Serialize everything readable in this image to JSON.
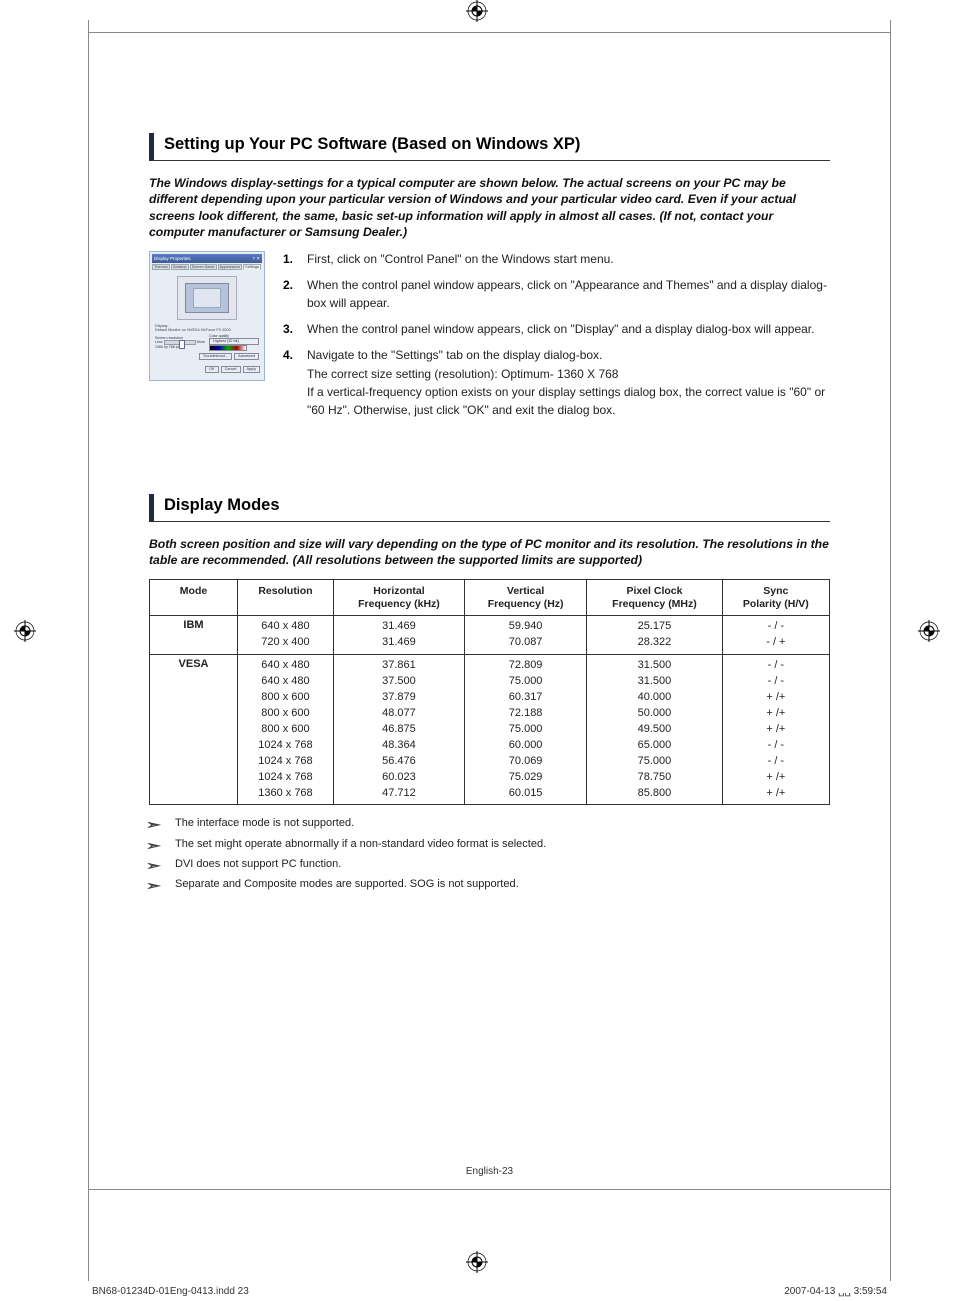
{
  "section1": {
    "heading": "Setting up Your PC Software (Based on Windows XP)",
    "intro": "The Windows display-settings for a typical computer are shown below. The actual screens on your PC may be different depending upon your particular version of Windows and your particular video card. Even if your actual screens look different, the same, basic set-up information will apply in almost all cases. (If not, contact your computer manufacturer or Samsung Dealer.)",
    "dialog": {
      "title": "Display Properties",
      "tabs": [
        "Themes",
        "Desktop",
        "Screen Saver",
        "Appearance",
        "Settings"
      ],
      "display_label": "Display:",
      "display_value": "Default Monitor on NVIDIA GeForce FX 5200",
      "res_label_left": "Screen resolution",
      "res_label_right": "Color quality",
      "less": "Less",
      "more": "More",
      "color_quality": "Highest (32 bit)",
      "res_value": "1360 by 768 pixels",
      "troubleshoot": "Troubleshoot...",
      "advanced": "Advanced",
      "ok": "OK",
      "cancel": "Cancel",
      "apply": "Apply"
    },
    "steps": [
      {
        "n": "1.",
        "lines": [
          "First, click on \"Control Panel\" on the Windows start menu."
        ]
      },
      {
        "n": "2.",
        "lines": [
          "When the control panel window appears, click on \"Appearance and Themes\" and a display dialog-box will appear."
        ]
      },
      {
        "n": "3.",
        "lines": [
          "When the control panel window appears, click on \"Display\" and a display dialog-box will appear."
        ]
      },
      {
        "n": "4.",
        "lines": [
          "Navigate to the \"Settings\" tab on the display dialog-box.",
          "The correct size setting (resolution): Optimum- 1360 X 768",
          "If a vertical-frequency option exists on your display settings dialog box, the correct value is \"60\" or \"60 Hz\". Otherwise, just click \"OK\" and exit the dialog box."
        ]
      }
    ]
  },
  "section2": {
    "heading": "Display Modes",
    "intro": "Both screen position and size will vary depending on the type of PC monitor and its resolution. The resolutions in the table are recommended. (All resolutions between the supported limits are supported)",
    "headers": [
      "Mode",
      "Resolution",
      "Horizontal Frequency (kHz)",
      "Vertical Frequency (Hz)",
      "Pixel Clock Frequency (MHz)",
      "Sync Polarity (H/V)"
    ],
    "groups": [
      {
        "mode": "IBM",
        "rows": [
          {
            "res": "640 x 480",
            "h": "31.469",
            "v": "59.940",
            "p": "25.175",
            "s": "- / -"
          },
          {
            "res": "720 x 400",
            "h": "31.469",
            "v": "70.087",
            "p": "28.322",
            "s": "- / +"
          }
        ]
      },
      {
        "mode": "VESA",
        "rows": [
          {
            "res": "640 x 480",
            "h": "37.861",
            "v": "72.809",
            "p": "31.500",
            "s": "- / -"
          },
          {
            "res": "640 x 480",
            "h": "37.500",
            "v": "75.000",
            "p": "31.500",
            "s": "- / -"
          },
          {
            "res": "800 x 600",
            "h": "37.879",
            "v": "60.317",
            "p": "40.000",
            "s": "+ /+"
          },
          {
            "res": "800 x 600",
            "h": "48.077",
            "v": "72.188",
            "p": "50.000",
            "s": "+ /+"
          },
          {
            "res": "800 x 600",
            "h": "46.875",
            "v": "75.000",
            "p": "49.500",
            "s": "+ /+"
          },
          {
            "res": "1024 x 768",
            "h": "48.364",
            "v": "60.000",
            "p": "65.000",
            "s": "- / -"
          },
          {
            "res": "1024 x 768",
            "h": "56.476",
            "v": "70.069",
            "p": "75.000",
            "s": "- / -"
          },
          {
            "res": "1024 x 768",
            "h": "60.023",
            "v": "75.029",
            "p": "78.750",
            "s": "+ /+"
          },
          {
            "res": "1360 x 768",
            "h": "47.712",
            "v": "60.015",
            "p": "85.800",
            "s": "+ /+"
          }
        ]
      }
    ],
    "notes": [
      "The interface mode is not supported.",
      "The set might operate abnormally if a non-standard video format is selected.",
      "DVI does not support PC function.",
      "Separate and Composite modes are supported. SOG is not supported."
    ]
  },
  "footer": {
    "pagenum": "English-23",
    "file": "BN68-01234D-01Eng-0413.indd   23",
    "time": "2007-04-13   ␣␣ 3:59:54"
  }
}
